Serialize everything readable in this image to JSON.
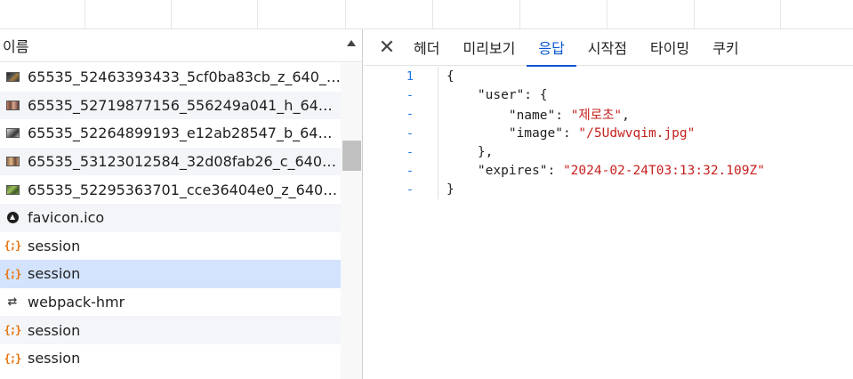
{
  "network": {
    "column_name": "이름",
    "requests": [
      {
        "name": "65535_52463393433_5cf0ba83cb_z_640_4...",
        "icon": "image-thumbnail-icon"
      },
      {
        "name": "65535_52719877156_556249a041_h_640_...",
        "icon": "image-thumbnail-icon"
      },
      {
        "name": "65535_52264899193_e12ab28547_b_640_...",
        "icon": "image-thumbnail-icon"
      },
      {
        "name": "65535_53123012584_32d08fab26_c_640_4...",
        "icon": "image-thumbnail-icon"
      },
      {
        "name": "65535_52295363701_cce36404e0_z_640_4...",
        "icon": "image-thumbnail-icon"
      },
      {
        "name": "favicon.ico",
        "icon": "favicon-icon"
      },
      {
        "name": "session",
        "icon": "json-icon"
      },
      {
        "name": "session",
        "icon": "json-icon",
        "selected": true
      },
      {
        "name": "webpack-hmr",
        "icon": "websocket-icon"
      },
      {
        "name": "session",
        "icon": "json-icon"
      },
      {
        "name": "session",
        "icon": "json-icon"
      }
    ]
  },
  "details": {
    "close_glyph": "✕",
    "tabs": [
      "헤더",
      "미리보기",
      "응답",
      "시작점",
      "타이밍",
      "쿠키"
    ],
    "active_tab": "응답",
    "response": {
      "line_numbers": [
        "1",
        "-",
        "-",
        "-",
        "-",
        "-",
        "-"
      ],
      "lines": [
        {
          "indent": "",
          "parts": [
            {
              "t": "{",
              "k": "txt"
            }
          ]
        },
        {
          "indent": "    ",
          "parts": [
            {
              "t": "\"user\": {",
              "k": "txt"
            }
          ]
        },
        {
          "indent": "        ",
          "parts": [
            {
              "t": "\"name\": ",
              "k": "txt"
            },
            {
              "t": "\"제로초\"",
              "k": "str"
            },
            {
              "t": ",",
              "k": "txt"
            }
          ]
        },
        {
          "indent": "        ",
          "parts": [
            {
              "t": "\"image\": ",
              "k": "txt"
            },
            {
              "t": "\"/5Udwvqim.jpg\"",
              "k": "str"
            }
          ]
        },
        {
          "indent": "    ",
          "parts": [
            {
              "t": "},",
              "k": "txt"
            }
          ]
        },
        {
          "indent": "    ",
          "parts": [
            {
              "t": "\"expires\": ",
              "k": "txt"
            },
            {
              "t": "\"2024-02-24T03:13:32.109Z\"",
              "k": "str"
            }
          ]
        },
        {
          "indent": "",
          "parts": [
            {
              "t": "}",
              "k": "txt"
            }
          ]
        }
      ]
    }
  },
  "colors": {
    "accent": "#0b57d0",
    "selected_row": "#d3e3fd",
    "json_string": "#c5221f",
    "json_icon": "#e8710a"
  }
}
